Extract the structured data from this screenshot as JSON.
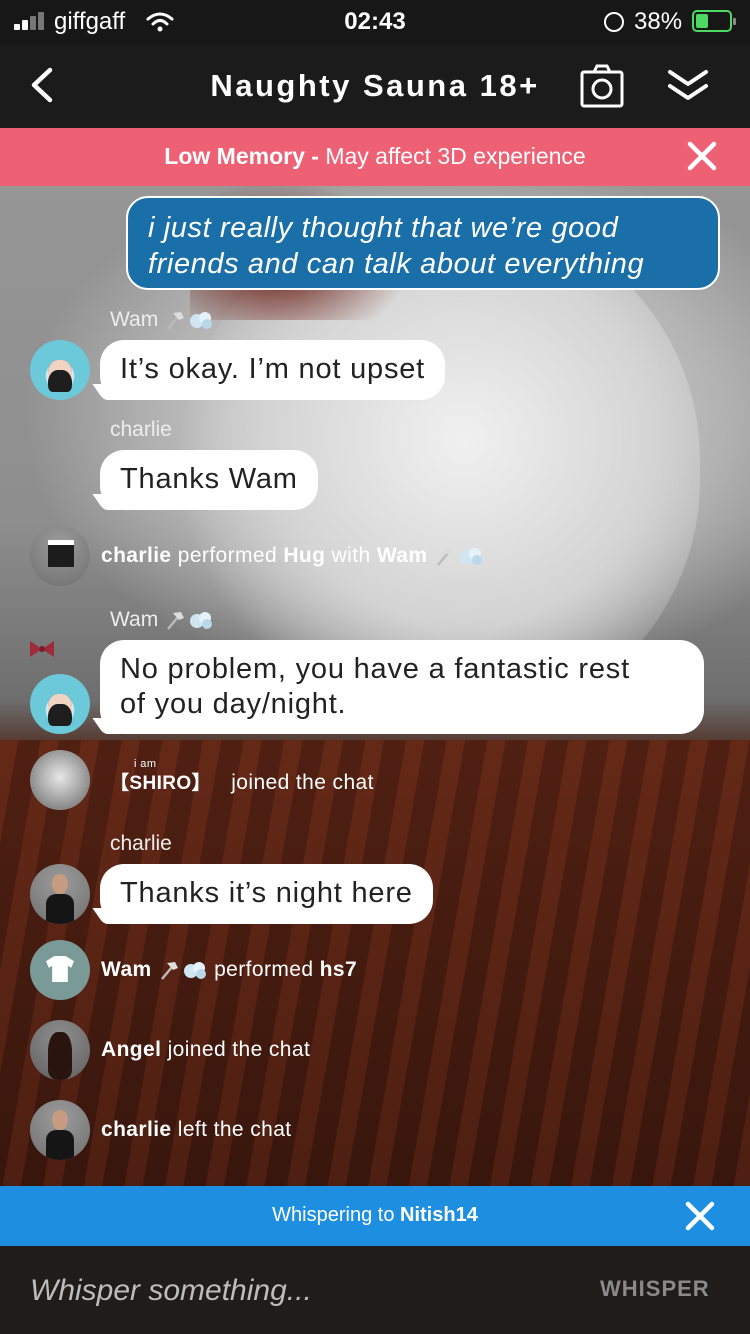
{
  "status_bar": {
    "carrier": "giffgaff",
    "time": "02:43",
    "battery_percent": "38%",
    "battery_level": 0.38,
    "battery_color": "#4cd964"
  },
  "nav": {
    "title": "Naughty Sauna 18+",
    "back_icon": "chevron-left-icon",
    "camera_icon": "camera-icon",
    "collapse_icon": "double-chevron-down-icon"
  },
  "banner": {
    "bold_text": "Low Memory -",
    "text": "May affect 3D experience",
    "color": "#ee6074"
  },
  "chat": {
    "my_message": {
      "line1": "i just really thought that we’re good",
      "line2": "friends and can talk about everything",
      "color": "#1b6fa8"
    },
    "messages": [
      {
        "sender": "Wam",
        "text": "It’s okay. I’m not upset"
      },
      {
        "sender": "charlie",
        "text": "Thanks Wam"
      },
      {
        "sender": "Wam",
        "line1": "No problem, you have a fantastic rest",
        "line2": "of you day/night."
      },
      {
        "sender": "charlie",
        "text": "Thanks it’s night here"
      }
    ],
    "events": [
      {
        "actor": "charlie",
        "verb": "performed",
        "action": "Hug",
        "with_word": "with",
        "target": "Wam"
      },
      {
        "actor_prefix": "i am",
        "actor": "【SHIRO】",
        "text": "joined the chat"
      },
      {
        "actor": "Wam",
        "verb": "performed",
        "action": "hs7"
      },
      {
        "actor": "Angel",
        "text": "joined the chat"
      },
      {
        "actor": "charlie",
        "text": "left the chat"
      }
    ]
  },
  "whisper": {
    "label": "Whispering to",
    "target": "Nitish14",
    "color": "#1e8fe0",
    "placeholder": "Whisper something...",
    "send_label": "WHISPER"
  }
}
